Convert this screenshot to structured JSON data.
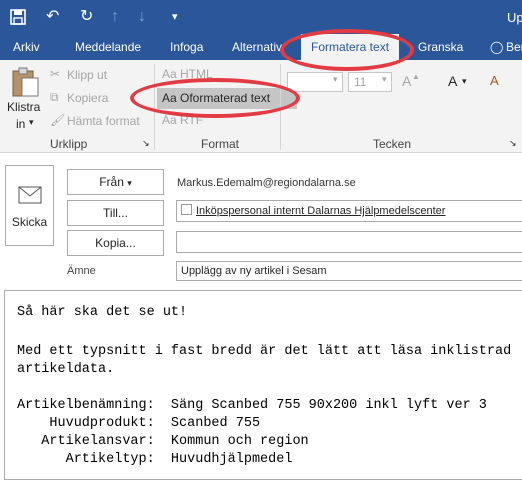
{
  "window": {
    "title_fragment": "Upp"
  },
  "ribbon_tabs": [
    "Arkiv",
    "Meddelande",
    "Infoga",
    "Alternativ",
    "Formatera text",
    "Granska",
    "Ber"
  ],
  "ribbon": {
    "clipboard": {
      "paste_label_line1": "Klistra",
      "paste_label_line2": "in",
      "cut": "Klipp ut",
      "copy": "Kopiera",
      "format_painter": "Hämta format",
      "group": "Urklipp"
    },
    "format": {
      "html": "HTML",
      "plain": "Oformaterad text",
      "rtf": "RTF",
      "aa": "Aa",
      "group": "Format"
    },
    "font": {
      "size": "11",
      "grow": "A",
      "shrink": "A",
      "group": "Tecken"
    }
  },
  "compose": {
    "send": "Skicka",
    "from_button": "Från",
    "from_value": "Markus.Edemalm@regiondalarna.se",
    "to_button": "Till...",
    "to_value": "Inköpspersonal internt Dalarnas Hjälpmedelscenter",
    "cc_button": "Kopia...",
    "cc_value": "",
    "subject_label": "Ämne",
    "subject_value": "Upplägg av ny artikel i Sesam"
  },
  "message_lines": [
    "Så här ska det se ut!",
    "",
    "Med ett typsnitt i fast bredd är det lätt att läsa inklistrad",
    "artikeldata.",
    "",
    "Artikelbenämning:  Säng Scanbed 755 90x200 inkl lyft ver 3",
    "    Huvudprodukt:  Scanbed 755",
    "   Artikelansvar:  Kommun och region",
    "      Artikeltyp:  Huvudhjälpmedel"
  ],
  "colors": {
    "accent": "#2b579a",
    "highlight": "#e23b43"
  }
}
